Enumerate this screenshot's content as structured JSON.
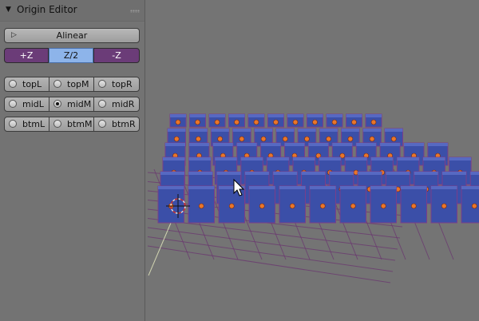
{
  "panel": {
    "title": "Origin Editor",
    "collapse_icon": "▼",
    "dropdown_value": "Alinear",
    "dropdown_icon": "▷",
    "axis_buttons": [
      "+Z",
      "Z/2",
      "-Z"
    ],
    "selected_axis": "Z/2",
    "radio_rows": [
      [
        "topL",
        "topM",
        "topR"
      ],
      [
        "midL",
        "midM",
        "midR"
      ],
      [
        "btmL",
        "btmM",
        "btmR"
      ]
    ],
    "selected_radio": "midM"
  },
  "viewport": {
    "colors": {
      "box": "#3b4fa8",
      "edge": "#7a3e8a",
      "dot": "#e8762a",
      "grid": "#6b3a70"
    }
  }
}
